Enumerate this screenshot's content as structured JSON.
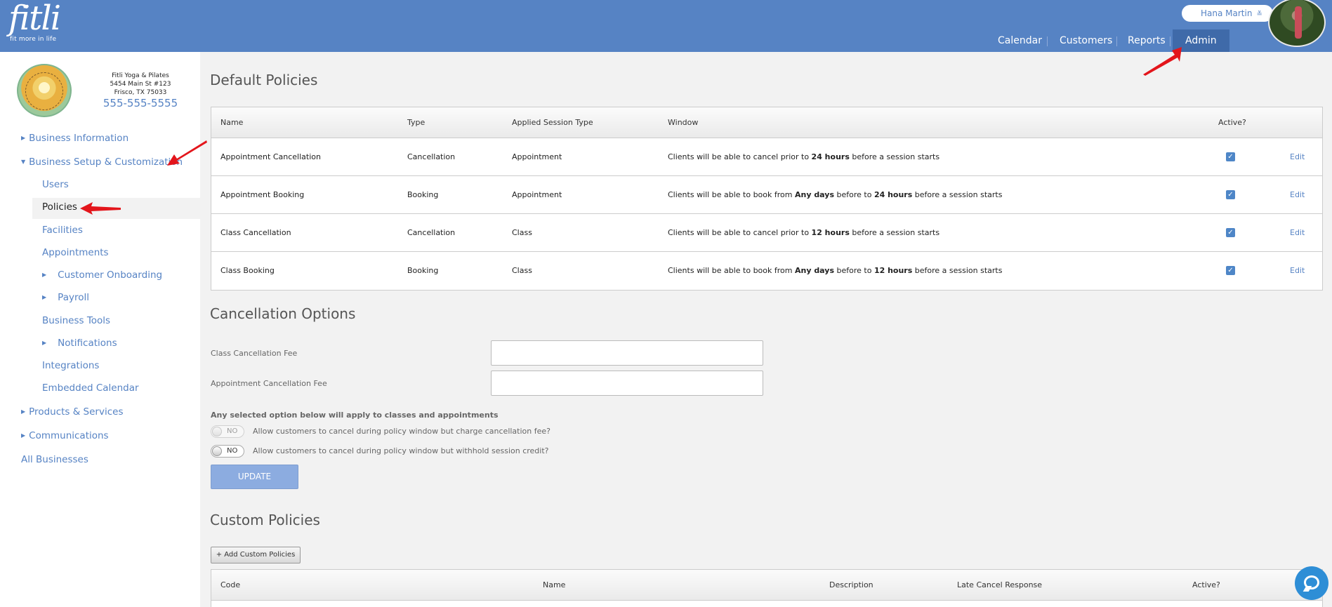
{
  "header": {
    "logo_word": "fitli",
    "logo_tagline": "fit more in life",
    "user_name": "Hana Martin",
    "user_caret": "≚",
    "nav": [
      "Calendar",
      "Customers",
      "Reports",
      "Admin"
    ],
    "active_nav": "Admin"
  },
  "sidebar": {
    "business_name": "Fitli Yoga & Pilates",
    "address_line1": "5454 Main St #123",
    "address_line2": "Frisco, TX 75033",
    "phone": "555-555-5555",
    "items": [
      {
        "label": "Business Information",
        "level": 0,
        "expander": "right"
      },
      {
        "label": "Business Setup & Customization",
        "level": 0,
        "expander": "down"
      },
      {
        "label": "Users",
        "level": 1
      },
      {
        "label": "Policies",
        "level": 1,
        "current": true
      },
      {
        "label": "Facilities",
        "level": 1
      },
      {
        "label": "Appointments",
        "level": 1
      },
      {
        "label": "Customer Onboarding",
        "level": 1,
        "expander": "right"
      },
      {
        "label": "Payroll",
        "level": 1,
        "expander": "right"
      },
      {
        "label": "Business Tools",
        "level": 1
      },
      {
        "label": "Notifications",
        "level": 1,
        "expander": "right"
      },
      {
        "label": "Integrations",
        "level": 1
      },
      {
        "label": "Embedded Calendar",
        "level": 1
      },
      {
        "label": "Products & Services",
        "level": 0,
        "expander": "right"
      },
      {
        "label": "Communications",
        "level": 0,
        "expander": "right"
      },
      {
        "label": "All Businesses",
        "level": 0
      }
    ]
  },
  "default_policies": {
    "title": "Default Policies",
    "columns": [
      "Name",
      "Type",
      "Applied Session Type",
      "Window",
      "Active?"
    ],
    "rows": [
      {
        "name": "Appointment Cancellation",
        "type": "Cancellation",
        "session_type": "Appointment",
        "window": [
          {
            "t": "Clients will be able to cancel prior to "
          },
          {
            "t": "24 hours",
            "b": true
          },
          {
            "t": " before a session starts"
          }
        ],
        "active": true,
        "action": "Edit"
      },
      {
        "name": "Appointment Booking",
        "type": "Booking",
        "session_type": "Appointment",
        "window": [
          {
            "t": "Clients will be able to book from "
          },
          {
            "t": "Any days",
            "b": true
          },
          {
            "t": " before to "
          },
          {
            "t": "24 hours",
            "b": true
          },
          {
            "t": " before a session starts"
          }
        ],
        "active": true,
        "action": "Edit"
      },
      {
        "name": "Class Cancellation",
        "type": "Cancellation",
        "session_type": "Class",
        "window": [
          {
            "t": "Clients will be able to cancel prior to "
          },
          {
            "t": "12 hours",
            "b": true
          },
          {
            "t": " before a session starts"
          }
        ],
        "active": true,
        "action": "Edit"
      },
      {
        "name": "Class Booking",
        "type": "Booking",
        "session_type": "Class",
        "window": [
          {
            "t": "Clients will be able to book from "
          },
          {
            "t": "Any days",
            "b": true
          },
          {
            "t": " before to "
          },
          {
            "t": "12 hours",
            "b": true
          },
          {
            "t": " before a session starts"
          }
        ],
        "active": true,
        "action": "Edit"
      }
    ]
  },
  "cancellation_options": {
    "title": "Cancellation Options",
    "class_fee_label": "Class Cancellation Fee",
    "class_fee_value": "",
    "appointment_fee_label": "Appointment Cancellation Fee",
    "appointment_fee_value": "",
    "note": "Any selected option below will apply to classes and appointments",
    "toggles": [
      {
        "state": "NO",
        "label": "Allow customers to cancel during policy window but charge cancellation fee?",
        "disabled": true
      },
      {
        "state": "NO",
        "label": "Allow customers to cancel during policy window but withhold session credit?",
        "disabled": false
      }
    ],
    "update_label": "UPDATE"
  },
  "custom_policies": {
    "title": "Custom Policies",
    "add_label": "+ Add Custom Policies",
    "columns": [
      "Code",
      "Name",
      "Description",
      "Late Cancel Response",
      "Active?"
    ]
  }
}
